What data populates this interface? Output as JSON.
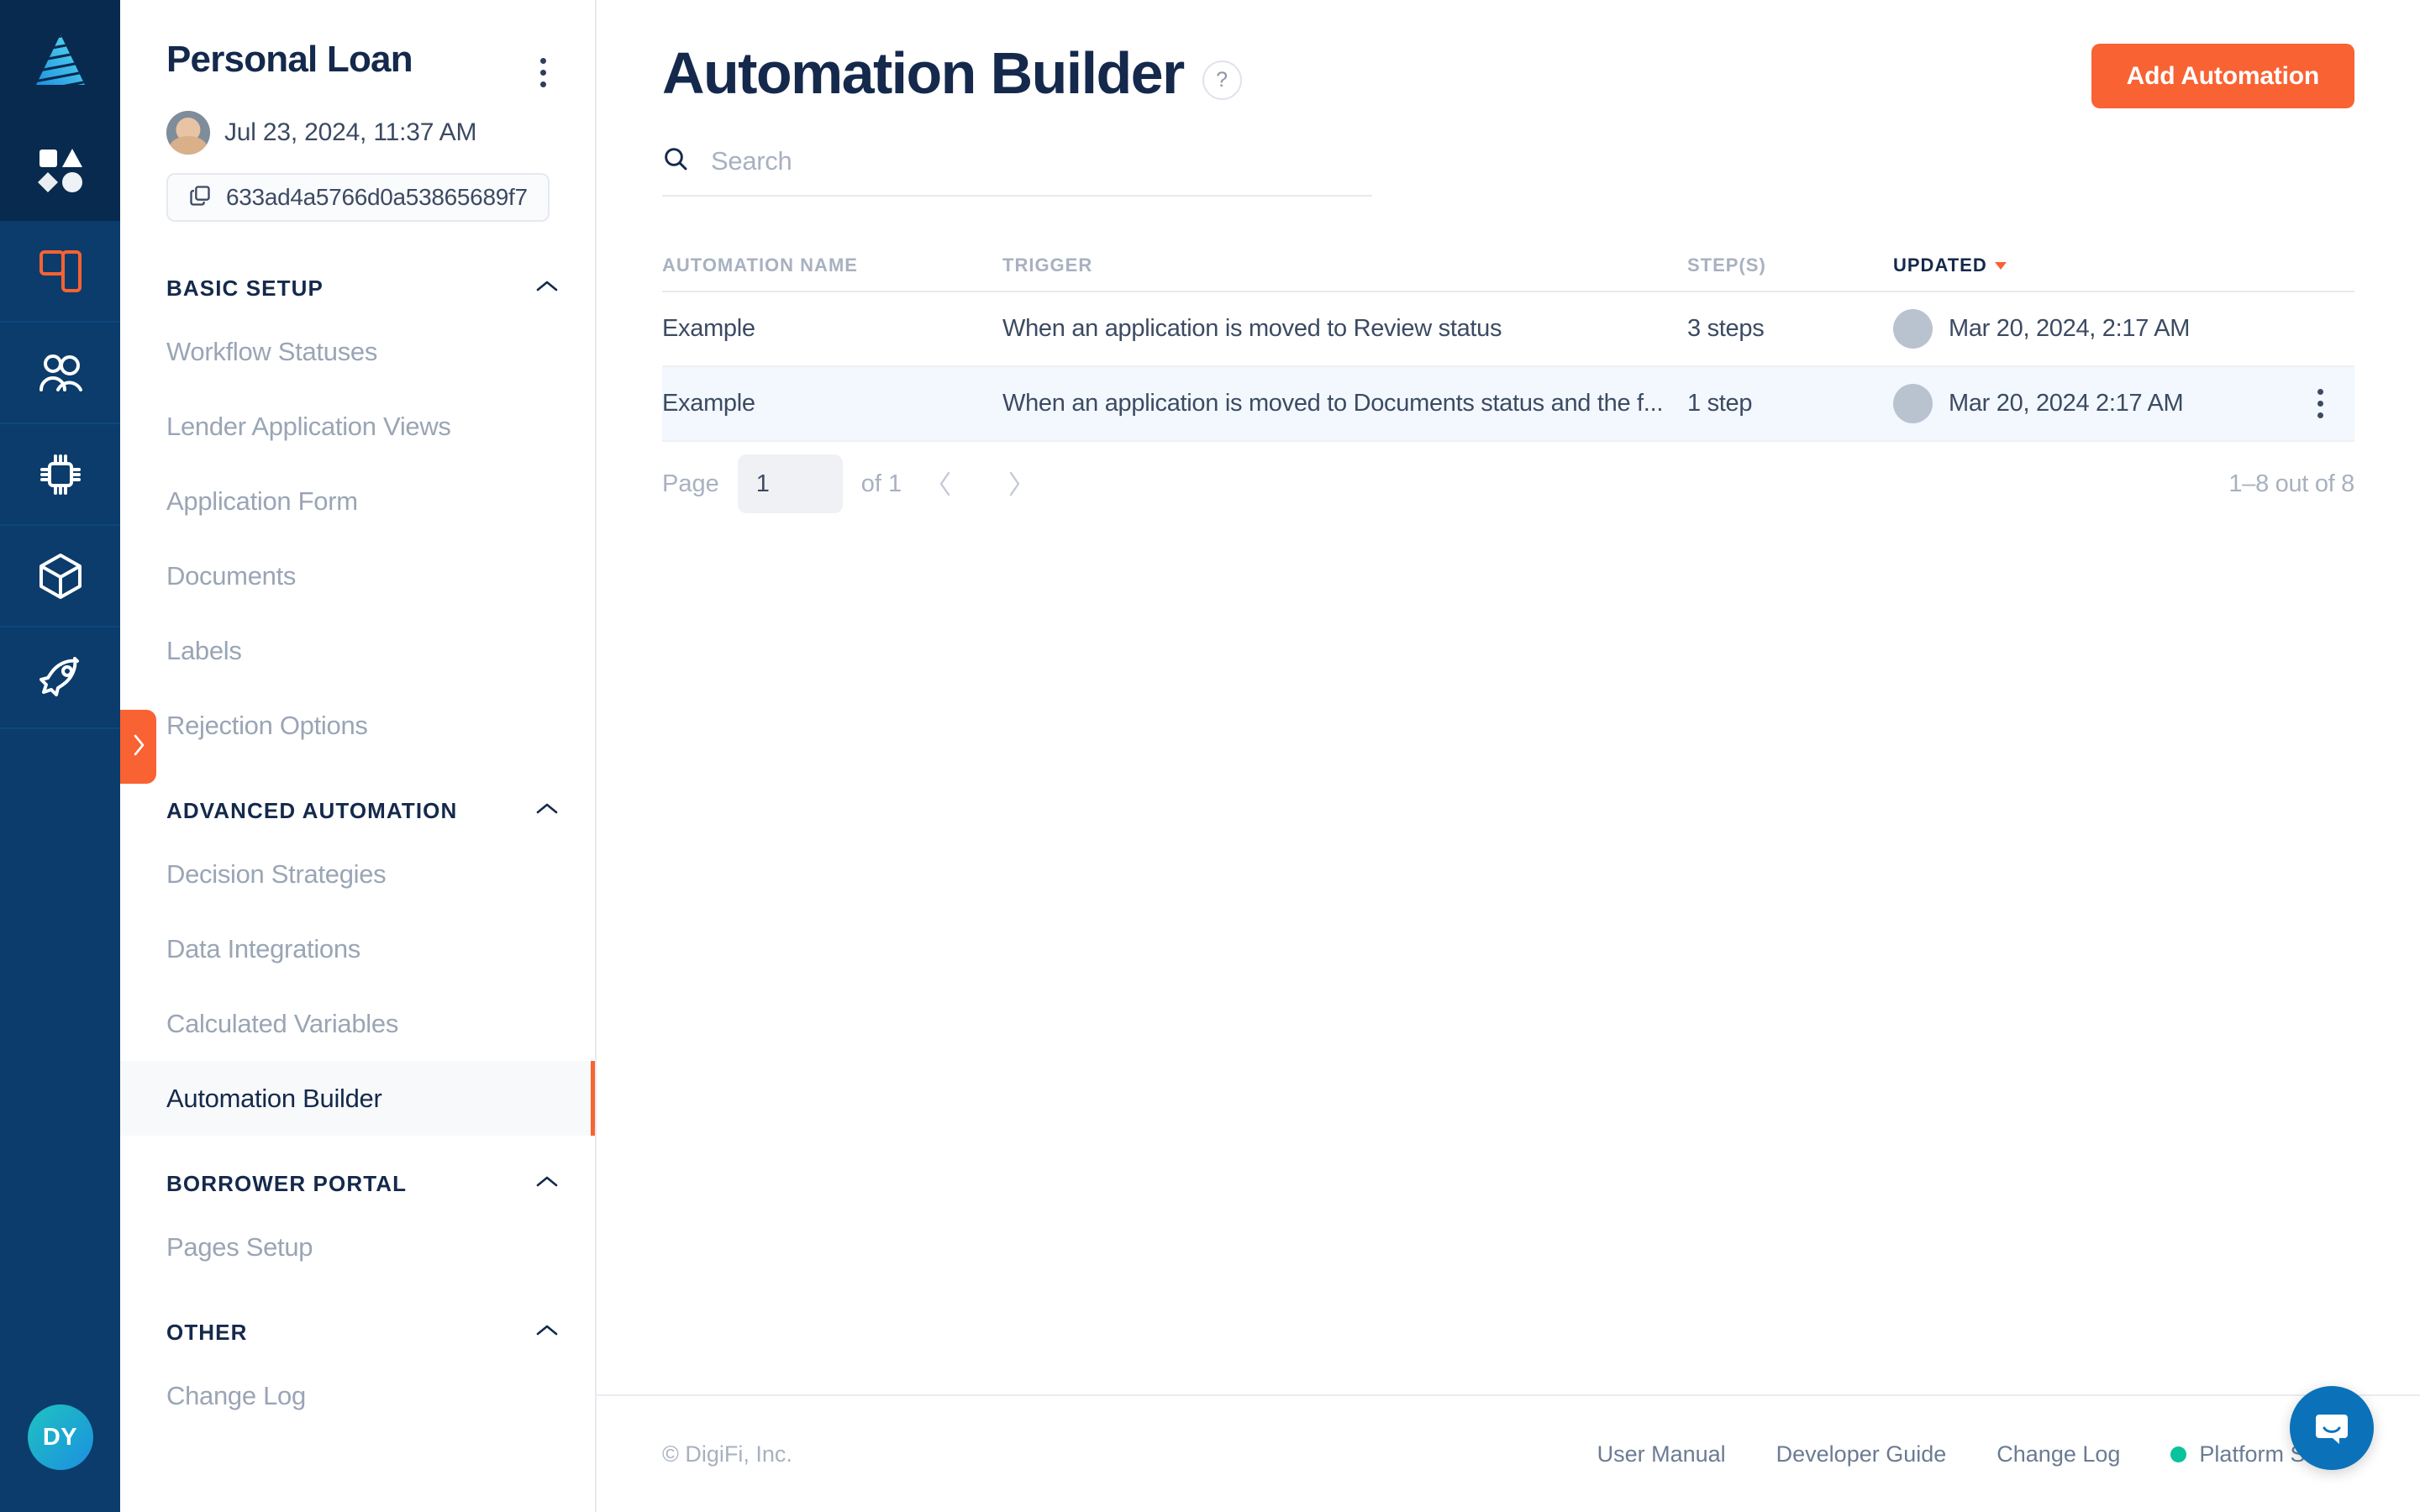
{
  "rail": {
    "logo_icon": "digifi-logo-icon",
    "items": [
      {
        "icon": "shapes-icon",
        "name": "rail-item-shapes",
        "active": true
      },
      {
        "icon": "layout-panels-icon",
        "name": "rail-item-layout",
        "active": false
      },
      {
        "icon": "users-icon",
        "name": "rail-item-users",
        "active": false
      },
      {
        "icon": "chip-icon",
        "name": "rail-item-processing",
        "active": false
      },
      {
        "icon": "cube-icon",
        "name": "rail-item-products",
        "active": false
      },
      {
        "icon": "rocket-icon",
        "name": "rail-item-launch",
        "active": false
      }
    ],
    "user_initials": "DY"
  },
  "sidebar": {
    "title": "Personal Loan",
    "kebab_icon": "more-vertical-icon",
    "updated_date": "Jul 23, 2024, 11:37 AM",
    "copy_icon": "copy-icon",
    "record_id": "633ad4a5766d0a53865689f7",
    "expander_icon": "chevron-right-icon",
    "collapse_icon": "chevron-up-icon",
    "sections": [
      {
        "label": "BASIC SETUP",
        "items": [
          {
            "label": "Workflow Statuses",
            "active": false
          },
          {
            "label": "Lender Application Views",
            "active": false
          },
          {
            "label": "Application Form",
            "active": false
          },
          {
            "label": "Documents",
            "active": false
          },
          {
            "label": "Labels",
            "active": false
          },
          {
            "label": "Rejection Options",
            "active": false
          }
        ]
      },
      {
        "label": "ADVANCED AUTOMATION",
        "items": [
          {
            "label": "Decision Strategies",
            "active": false
          },
          {
            "label": "Data Integrations",
            "active": false
          },
          {
            "label": "Calculated Variables",
            "active": false
          },
          {
            "label": "Automation Builder",
            "active": true
          }
        ]
      },
      {
        "label": "BORROWER PORTAL",
        "items": [
          {
            "label": "Pages Setup",
            "active": false
          }
        ]
      },
      {
        "label": "OTHER",
        "items": [
          {
            "label": "Change Log",
            "active": false
          }
        ]
      }
    ]
  },
  "main": {
    "page_title": "Automation Builder",
    "help_icon": "question-mark-icon",
    "help_label": "?",
    "add_button": "Add Automation",
    "search": {
      "icon": "search-icon",
      "value": "",
      "placeholder": "Search"
    },
    "table": {
      "columns": [
        {
          "label": "AUTOMATION NAME",
          "sorted": false
        },
        {
          "label": "TRIGGER",
          "sorted": false
        },
        {
          "label": "STEP(S)",
          "sorted": false
        },
        {
          "label": "UPDATED",
          "sorted": true,
          "sort_direction": "desc"
        }
      ],
      "rows": [
        {
          "name": "Example",
          "trigger": "When an application is moved to Review status",
          "steps": "3 steps",
          "updated": "Mar 20, 2024, 2:17 AM",
          "highlighted": false,
          "kebab_visible": false
        },
        {
          "name": "Example",
          "trigger": "When an application is moved to Documents status and the f...",
          "steps": "1 step",
          "updated": "Mar 20, 2024 2:17 AM",
          "highlighted": true,
          "kebab_visible": true
        }
      ]
    },
    "pagination": {
      "page_label": "Page",
      "page_value": "1",
      "of_label": "of 1",
      "prev_icon": "chevron-left-icon",
      "next_icon": "chevron-right-icon",
      "count_label": "1–8 out of 8"
    }
  },
  "footer": {
    "copyright": "© DigiFi, Inc.",
    "links": [
      {
        "label": "User Manual"
      },
      {
        "label": "Developer Guide"
      },
      {
        "label": "Change Log"
      }
    ],
    "status_label": "Platform Status",
    "status_color": "#09c39b",
    "chat_icon": "chat-bubble-icon"
  },
  "colors": {
    "accent": "#f96232",
    "navy": "#14294c",
    "rail": "#0b3c6b",
    "rail_dark": "#072a4e",
    "row_highlight": "#f2f8fd"
  }
}
